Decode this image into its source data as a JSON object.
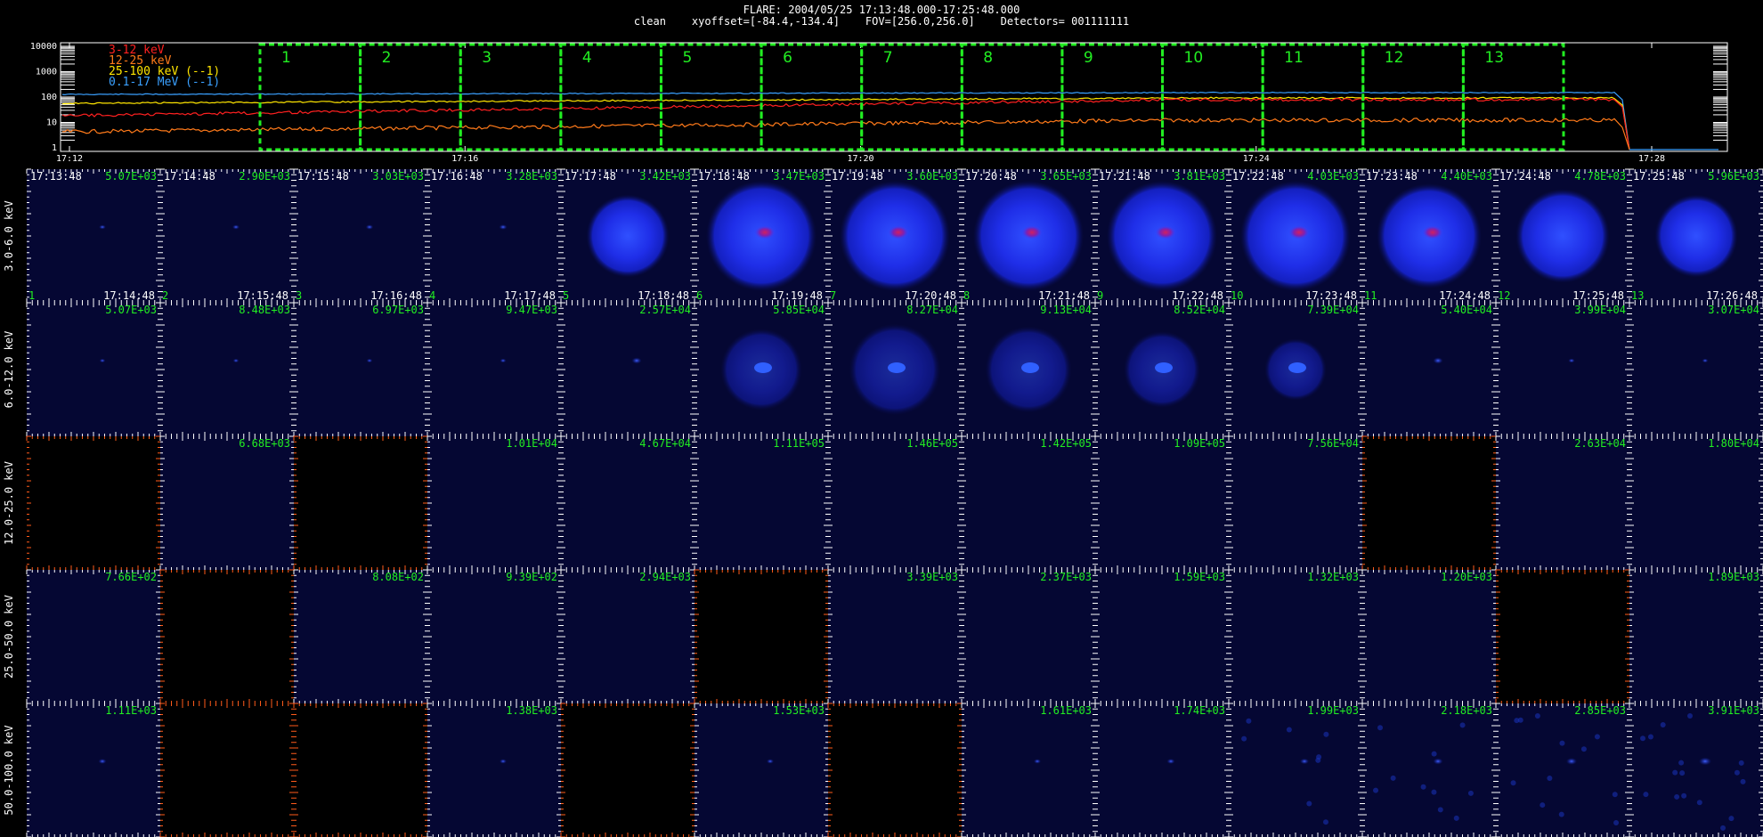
{
  "header": {
    "line1": "FLARE: 2004/05/25 17:13:48.000-17:25:48.000",
    "line2": "clean    xyoffset=[-84.4,-134.4]    FOV=[256.0,256.0]    Detectors= 001111111"
  },
  "lightcurve": {
    "y_ticks": [
      "10000",
      "1000",
      "100",
      "10",
      "1"
    ],
    "x_ticks": [
      "17:12",
      "17:16",
      "17:20",
      "17:24",
      "17:28"
    ],
    "legend": [
      {
        "label": "3-12 keV",
        "color": "#ff2020"
      },
      {
        "label": "12-25 keV",
        "color": "#ff7a1a"
      },
      {
        "label": "25-100 keV (--1)",
        "color": "#ffe600"
      },
      {
        "label": "0.1-17 MeV (--1)",
        "color": "#3aa0ff"
      }
    ],
    "intervals": [
      "1",
      "2",
      "3",
      "4",
      "5",
      "6",
      "7",
      "8",
      "9",
      "10",
      "11",
      "12",
      "13"
    ],
    "interval_color": "#22ee22"
  },
  "grid": {
    "start_times": [
      "17:13:48",
      "17:14:48",
      "17:15:48",
      "17:16:48",
      "17:17:48",
      "17:18:48",
      "17:19:48",
      "17:20:48",
      "17:21:48",
      "17:22:48",
      "17:23:48",
      "17:24:48",
      "17:25:48"
    ],
    "end_times": [
      "17:14:48",
      "17:15:48",
      "17:16:48",
      "17:17:48",
      "17:18:48",
      "17:19:48",
      "17:20:48",
      "17:21:48",
      "17:22:48",
      "17:23:48",
      "17:24:48",
      "17:25:48",
      "17:26:48"
    ],
    "frame_numbers": [
      "1",
      "2",
      "3",
      "4",
      "5",
      "6",
      "7",
      "8",
      "9",
      "10",
      "11",
      "12",
      "13"
    ],
    "rows": [
      {
        "label": "3.0-6.0 keV",
        "values": [
          "5.07E+03",
          "2.90E+03",
          "3.03E+03",
          "3.28E+03",
          "3.42E+03",
          "3.47E+03",
          "3.60E+03",
          "3.65E+03",
          "3.81E+03",
          "4.03E+03",
          "4.40E+03",
          "4.78E+03",
          "5.96E+03"
        ],
        "blank": [
          false,
          false,
          false,
          false,
          false,
          false,
          false,
          false,
          false,
          false,
          false,
          false,
          false
        ],
        "source": [
          0.08,
          0.1,
          0.12,
          0.15,
          0.75,
          1.0,
          1.0,
          1.0,
          1.0,
          1.0,
          0.95,
          0.85,
          0.75
        ]
      },
      {
        "label": "6.0-12.0 keV",
        "values": [
          "5.07E+03",
          "8.48E+03",
          "6.97E+03",
          "9.47E+03",
          "2.57E+04",
          "5.85E+04",
          "8.27E+04",
          "9.13E+04",
          "8.52E+04",
          "7.39E+04",
          "5.40E+04",
          "3.99E+04",
          "3.07E+04"
        ],
        "blank": [
          false,
          false,
          false,
          false,
          false,
          false,
          false,
          false,
          false,
          false,
          false,
          false,
          false
        ],
        "source": [
          0.03,
          0.03,
          0.03,
          0.05,
          0.25,
          0.65,
          0.75,
          0.7,
          0.6,
          0.45,
          0.25,
          0.06,
          0.04
        ]
      },
      {
        "label": "12.0-25.0 keV",
        "values": [
          "",
          "6.68E+03",
          "",
          "1.01E+04",
          "4.67E+04",
          "1.11E+05",
          "1.46E+05",
          "1.42E+05",
          "1.09E+05",
          "7.56E+04",
          "",
          "2.63E+04",
          "1.80E+04"
        ],
        "blank": [
          true,
          false,
          true,
          false,
          false,
          false,
          false,
          false,
          false,
          false,
          true,
          false,
          false
        ],
        "source": [
          0,
          0,
          0,
          0,
          0,
          0,
          0,
          0,
          0,
          0,
          0,
          0,
          0
        ]
      },
      {
        "label": "25.0-50.0 keV",
        "values": [
          "7.66E+02",
          "",
          "8.08E+02",
          "9.39E+02",
          "2.94E+03",
          "",
          "3.39E+03",
          "2.37E+03",
          "1.59E+03",
          "1.32E+03",
          "1.20E+03",
          "",
          "1.89E+03"
        ],
        "blank": [
          false,
          true,
          false,
          false,
          false,
          true,
          false,
          false,
          false,
          false,
          false,
          true,
          false
        ],
        "source": [
          0,
          0,
          0,
          0,
          0,
          0,
          0,
          0,
          0,
          0,
          0,
          0,
          0
        ]
      },
      {
        "label": "50.0-100.0 keV",
        "values": [
          "1.11E+03",
          "",
          "",
          "1.38E+03",
          "",
          "1.53E+03",
          "",
          "1.61E+03",
          "1.74E+03",
          "1.99E+03",
          "2.18E+03",
          "2.85E+03",
          "3.91E+03"
        ],
        "blank": [
          false,
          true,
          true,
          false,
          true,
          false,
          true,
          false,
          false,
          false,
          false,
          false,
          false
        ],
        "source": [
          0.15,
          0,
          0,
          0.1,
          0,
          0.1,
          0,
          0.1,
          0.15,
          0.2,
          0.25,
          0.3,
          0.4
        ]
      }
    ]
  }
}
